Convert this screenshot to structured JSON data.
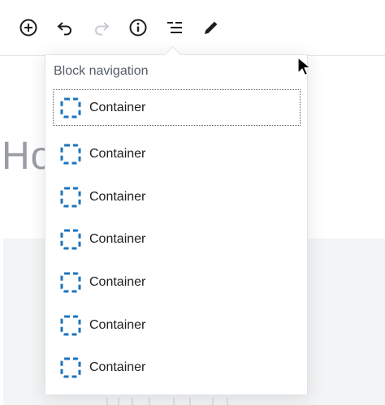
{
  "toolbar": {
    "buttons": [
      {
        "name": "add-block-button",
        "icon": "plus-circle-icon",
        "disabled": false
      },
      {
        "name": "undo-button",
        "icon": "undo-icon",
        "disabled": false
      },
      {
        "name": "redo-button",
        "icon": "redo-icon",
        "disabled": true
      },
      {
        "name": "info-button",
        "icon": "info-icon",
        "disabled": false
      },
      {
        "name": "block-navigation-button",
        "icon": "list-icon",
        "disabled": false
      },
      {
        "name": "edit-button",
        "icon": "pencil-icon",
        "disabled": false
      }
    ]
  },
  "background": {
    "heading_fragment": "Ho"
  },
  "popover": {
    "title": "Block navigation",
    "items": [
      {
        "label": "Container",
        "icon": "dashed-square-icon"
      },
      {
        "label": "Container",
        "icon": "dashed-square-icon"
      },
      {
        "label": "Container",
        "icon": "dashed-square-icon"
      },
      {
        "label": "Container",
        "icon": "dashed-square-icon"
      },
      {
        "label": "Container",
        "icon": "dashed-square-icon"
      },
      {
        "label": "Container",
        "icon": "dashed-square-icon"
      },
      {
        "label": "Container",
        "icon": "dashed-square-icon"
      }
    ]
  },
  "colors": {
    "icon_blue": "#1e73be",
    "text": "#1e1e1e",
    "muted": "#555d66",
    "disabled": "#c8ccd1"
  }
}
